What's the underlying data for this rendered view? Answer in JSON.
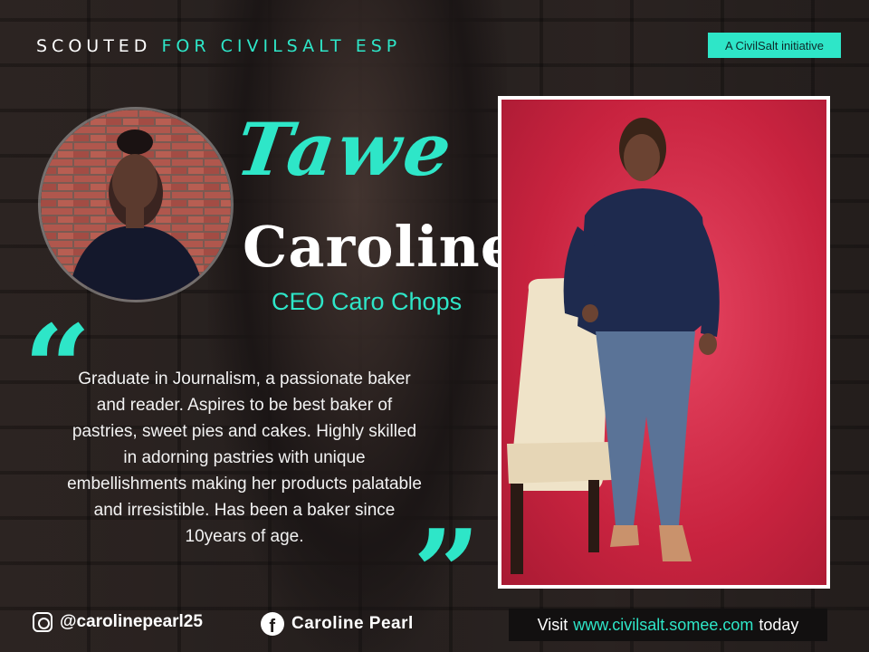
{
  "header": {
    "scouted": "SCOUTED ",
    "for_civilsalt": "FOR CIVILSALT ESP",
    "badge": "A CivilSalt initiative"
  },
  "profile": {
    "first_name": "Tawe",
    "last_name": "Caroline",
    "title": "CEO Caro Chops",
    "bio": "Graduate in Journalism, a passionate baker and reader. Aspires to be best baker of pastries, sweet pies and cakes. Highly skilled in adorning pastries with unique embellishments making her products palatable and irresistible.  Has been a baker since 10years of age."
  },
  "social": {
    "instagram_handle": "@carolinepearl25",
    "facebook_name": "Caroline  Pearl"
  },
  "footer": {
    "visit": "Visit",
    "url": "www.civilsalt.somee.com",
    "today": "today"
  },
  "icons": {
    "instagram": "instagram-icon",
    "facebook": "facebook-icon",
    "quote_open": "quote-open-icon",
    "quote_close": "quote-close-icon"
  },
  "colors": {
    "accent": "#2ee6c8",
    "photo_background": "#d42c48",
    "background": "#3a3230"
  }
}
